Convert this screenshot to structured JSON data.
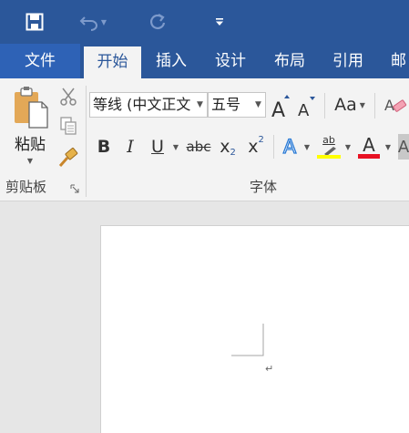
{
  "quick_access": {
    "save_icon": "save-icon",
    "undo_icon": "undo-icon",
    "redo_icon": "redo-icon",
    "customize_icon": "customize-dropdown-icon"
  },
  "tabs": [
    {
      "label": "文件"
    },
    {
      "label": "开始"
    },
    {
      "label": "插入"
    },
    {
      "label": "设计"
    },
    {
      "label": "布局"
    },
    {
      "label": "引用"
    },
    {
      "label": "邮"
    }
  ],
  "clipboard": {
    "paste_label": "粘贴",
    "group_label": "剪贴板"
  },
  "font": {
    "font_name": "等线 (中文正文",
    "font_size": "五号",
    "case_label": "Aa",
    "bold": "B",
    "italic": "I",
    "underline": "U",
    "strikethrough": "abc",
    "subscript": "x",
    "subscript_mark": "2",
    "superscript": "x",
    "superscript_mark": "2",
    "text_effect": "A",
    "highlight": "ab",
    "font_color": "A",
    "group_label": "字体"
  },
  "colors": {
    "brand": "#2b579a",
    "highlight_bar": "#ffff00",
    "font_color_bar": "#e81123"
  },
  "document": {
    "paragraph_mark": "↵"
  }
}
